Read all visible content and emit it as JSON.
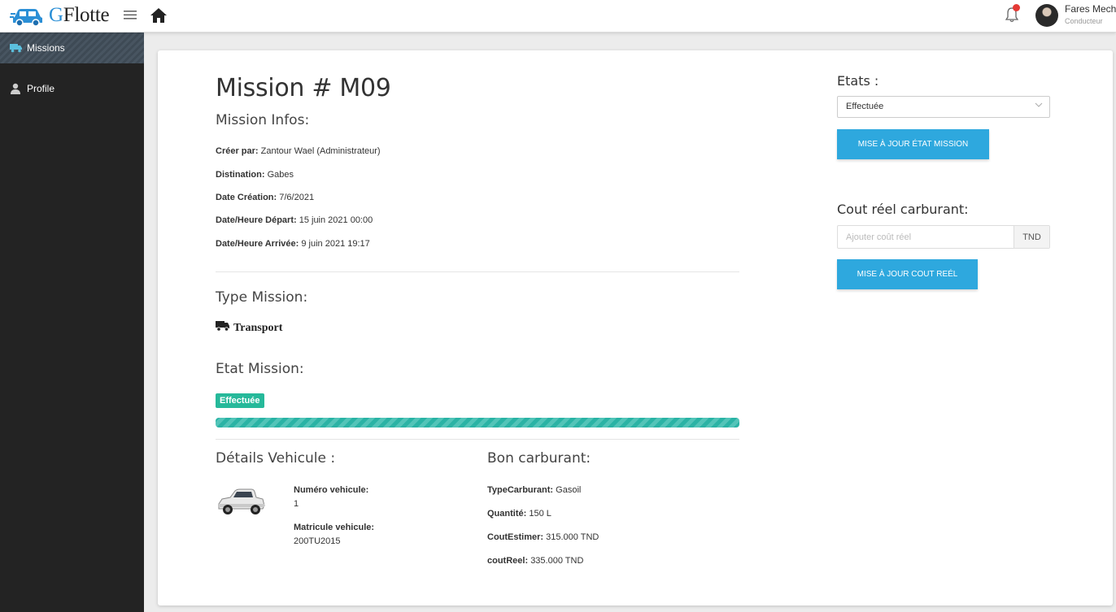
{
  "brand": {
    "name_first": "G",
    "name_rest": "Flotte"
  },
  "user": {
    "name": "Fares Mechri",
    "role": "Conducteur"
  },
  "sidebar": {
    "items": [
      {
        "label": "Missions",
        "icon": "truck-icon",
        "active": true
      },
      {
        "label": "Profile",
        "icon": "user-icon",
        "active": false
      }
    ]
  },
  "mission": {
    "title": "Mission # M09",
    "infos_title": "Mission Infos:",
    "creer_label": "Créer par:",
    "creer_value": "Zantour Wael (Administrateur)",
    "destination_label": "Distination:",
    "destination_value": "Gabes",
    "date_creation_label": "Date Création:",
    "date_creation_value": "7/6/2021",
    "depart_label": "Date/Heure Départ:",
    "depart_value": "15 juin 2021 00:00",
    "arrivee_label": "Date/Heure Arrivée:",
    "arrivee_value": "9 juin 2021 19:17",
    "type_title": "Type Mission:",
    "type_value": "Transport",
    "etat_title": "Etat Mission:",
    "etat_badge": "Effectuée",
    "etat_progress": 1.0
  },
  "vehicule": {
    "title": "Détails Vehicule :",
    "numero_label": "Numéro vehicule:",
    "numero_value": "1",
    "matricule_label": "Matricule vehicule:",
    "matricule_value": "200TU2015"
  },
  "bon": {
    "title": "Bon carburant:",
    "type_label": "TypeCarburant:",
    "type_value": "Gasoil",
    "quantite_label": "Quantité:",
    "quantite_value": "150 L",
    "cout_estimer_label": "CoutEstimer:",
    "cout_estimer_value": "315.000 TND",
    "cout_reel_label": "coutReel:",
    "cout_reel_value": "335.000 TND"
  },
  "etats": {
    "title": "Etats :",
    "selected": "Effectuée",
    "button": "Mise à jour état mission"
  },
  "cout": {
    "title": "Cout réel carburant:",
    "placeholder": "Ajouter coût réel",
    "addon": "TND",
    "button": "Mise à jour cout reél"
  },
  "colors": {
    "accent_blue": "#2ea8de",
    "success_green": "#26b99a",
    "sidebar_bg": "#232323",
    "notification_red": "#e53935"
  }
}
